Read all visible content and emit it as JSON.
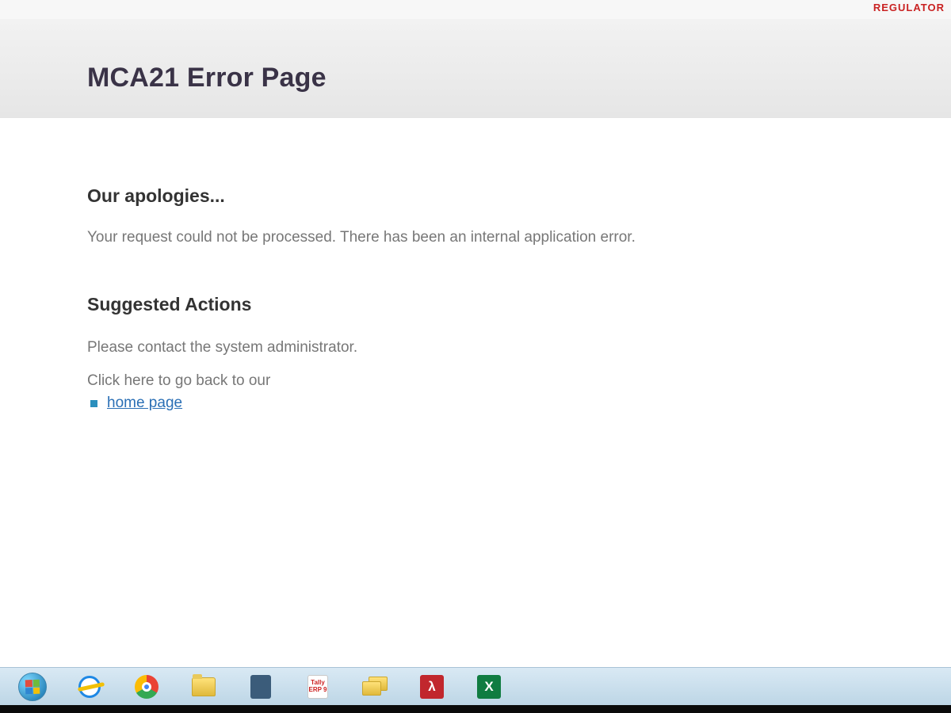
{
  "top": {
    "regulator": "REGULATOR"
  },
  "header": {
    "title": "MCA21 Error Page"
  },
  "main": {
    "apology_heading": "Our apologies...",
    "message": "Your request could not be processed. There has been an internal application error.",
    "suggest_heading": "Suggested Actions",
    "suggest_text": "Please contact the system administrator.",
    "back_text": "Click here to go back to our",
    "home_link": "home page"
  },
  "tally": {
    "line1": "Tally",
    "line2": "ERP 9"
  },
  "icons": {
    "adobe": "λ",
    "excel": "X"
  }
}
